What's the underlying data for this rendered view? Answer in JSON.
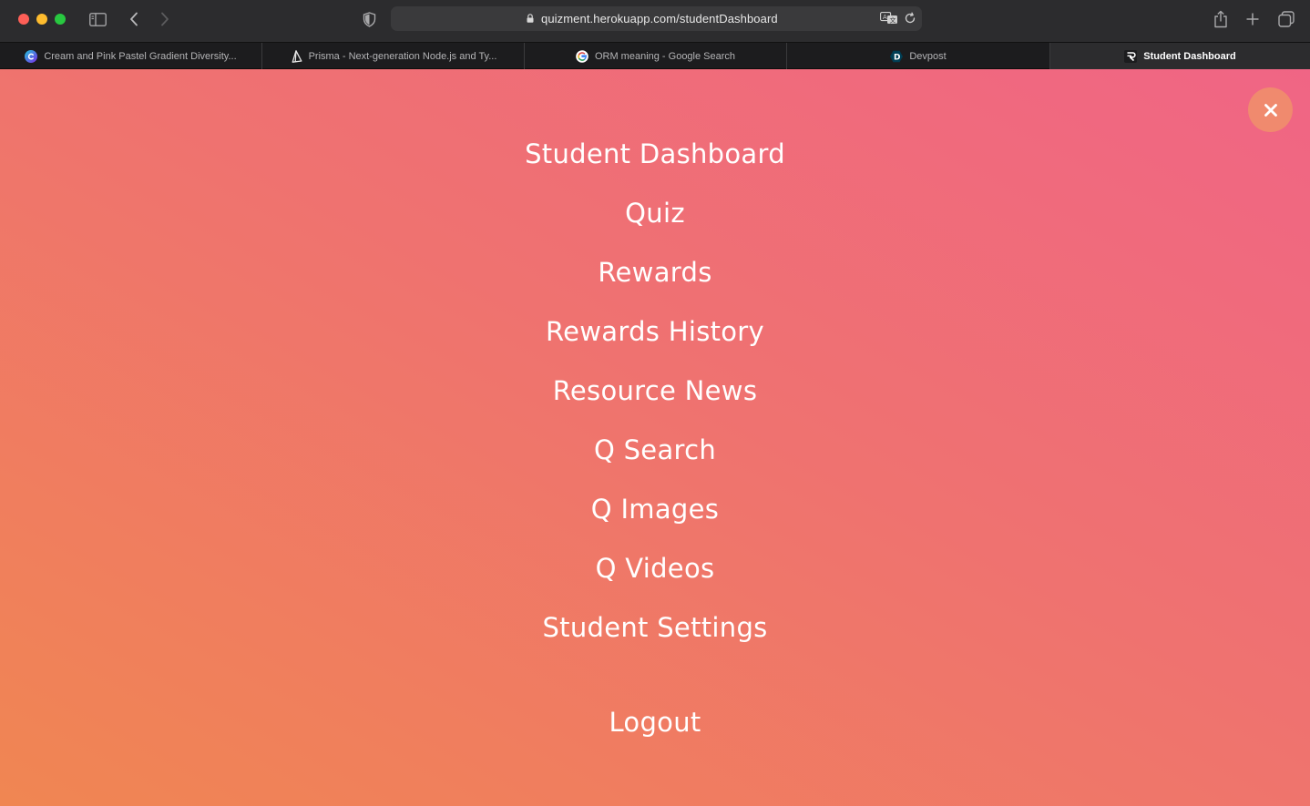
{
  "browser": {
    "url": "quizment.herokuapp.com/studentDashboard",
    "tabs": [
      {
        "label": "Cream and Pink Pastel Gradient Diversity...",
        "icon": "canva-icon",
        "active": false
      },
      {
        "label": "Prisma - Next-generation Node.js and Ty...",
        "icon": "prisma-icon",
        "active": false
      },
      {
        "label": "ORM meaning - Google Search",
        "icon": "google-icon",
        "active": false
      },
      {
        "label": "Devpost",
        "icon": "devpost-icon",
        "active": false
      },
      {
        "label": "Student Dashboard",
        "icon": "quizment-icon",
        "active": true
      }
    ]
  },
  "menu": {
    "items": [
      "Student Dashboard",
      "Quiz",
      "Rewards",
      "Rewards History",
      "Resource News",
      "Q Search",
      "Q Images",
      "Q Videos",
      "Student Settings"
    ],
    "logout": "Logout",
    "close_icon": "close-icon"
  },
  "colors": {
    "gradient_top_right": "#f06585",
    "gradient_bottom_left": "#f08652",
    "close_button": "#f08a6e",
    "menu_text": "#ffffff"
  }
}
